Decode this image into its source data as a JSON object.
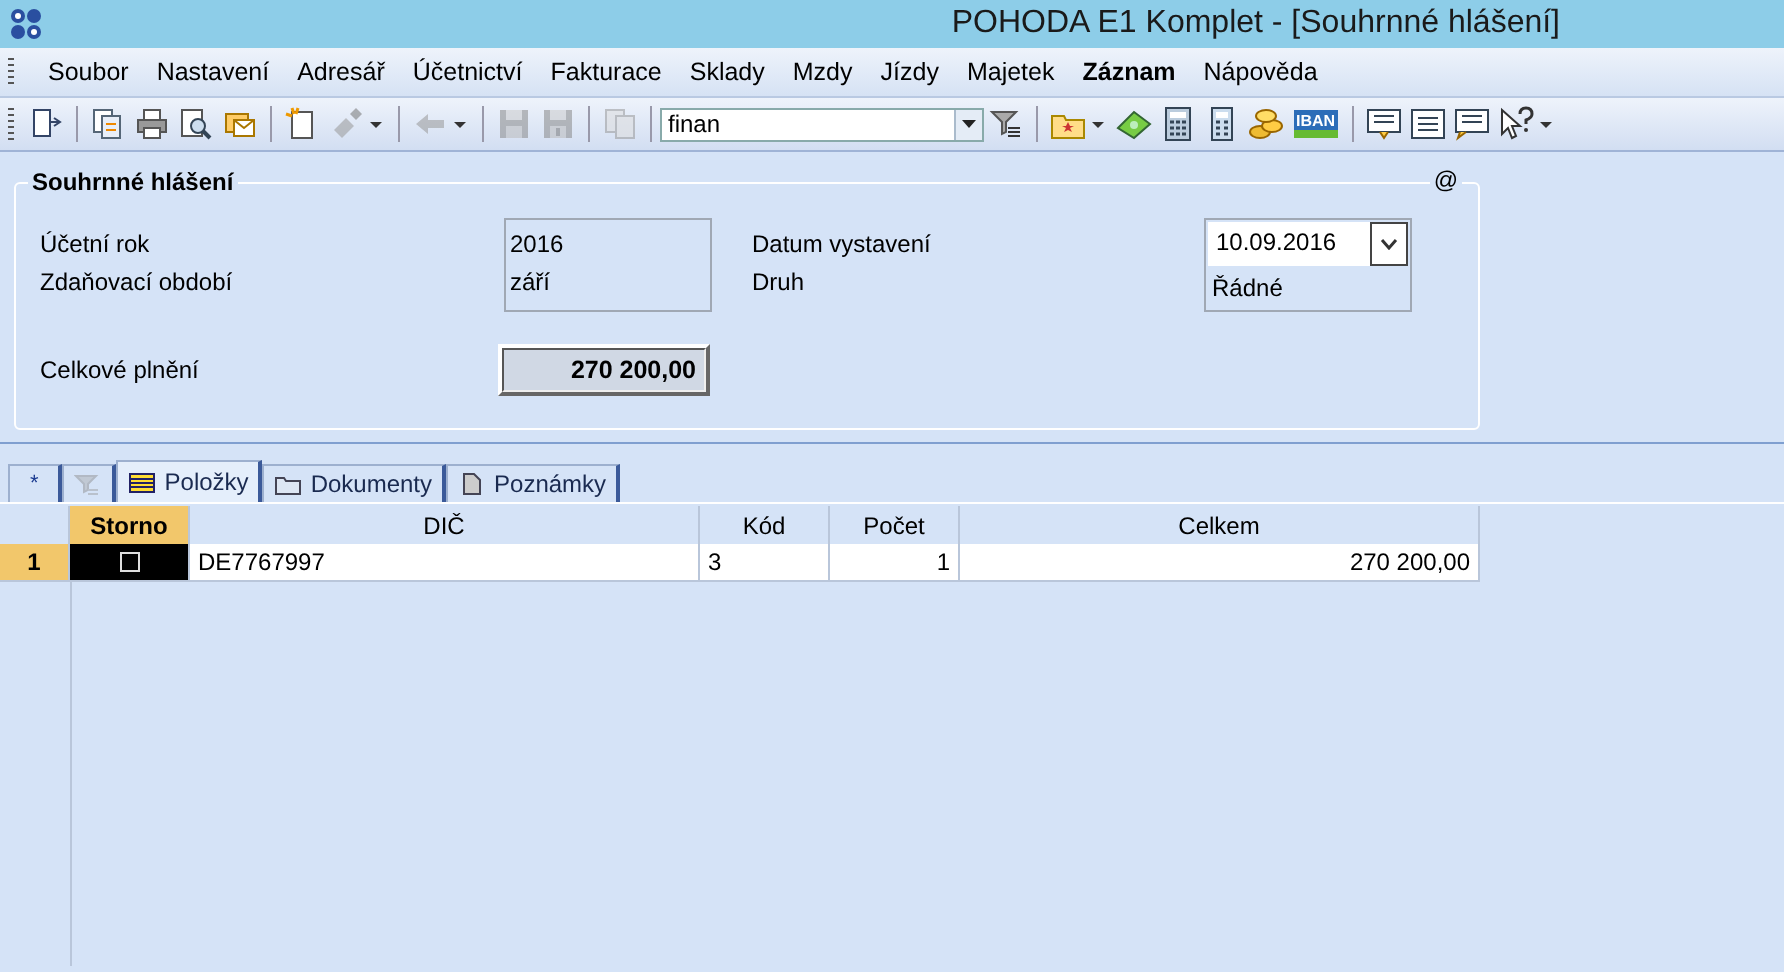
{
  "window": {
    "title": "POHODA E1 Komplet - [Souhrnné hlášení]"
  },
  "menu": [
    {
      "label": "Soubor",
      "emphasized": false
    },
    {
      "label": "Nastavení",
      "emphasized": false
    },
    {
      "label": "Adresář",
      "emphasized": false
    },
    {
      "label": "Účetnictví",
      "emphasized": false
    },
    {
      "label": "Fakturace",
      "emphasized": false
    },
    {
      "label": "Sklady",
      "emphasized": false
    },
    {
      "label": "Mzdy",
      "emphasized": false
    },
    {
      "label": "Jízdy",
      "emphasized": false
    },
    {
      "label": "Majetek",
      "emphasized": false
    },
    {
      "label": "Záznam",
      "emphasized": true
    },
    {
      "label": "Nápověda",
      "emphasized": false
    }
  ],
  "toolbar": [
    {
      "kind": "button",
      "disabled": false,
      "dropdown": false
    },
    {
      "kind": "separator"
    },
    {
      "kind": "button",
      "disabled": false,
      "dropdown": false
    },
    {
      "kind": "button",
      "disabled": false,
      "dropdown": false
    },
    {
      "kind": "button",
      "disabled": false,
      "dropdown": false
    },
    {
      "kind": "button",
      "disabled": false,
      "dropdown": false
    },
    {
      "kind": "separator"
    },
    {
      "kind": "button",
      "disabled": false,
      "dropdown": false
    },
    {
      "kind": "button",
      "disabled": true,
      "dropdown": true
    },
    {
      "kind": "separator"
    },
    {
      "kind": "button",
      "disabled": true,
      "dropdown": true
    },
    {
      "kind": "separator"
    },
    {
      "kind": "button",
      "disabled": true,
      "dropdown": false
    },
    {
      "kind": "button",
      "disabled": true,
      "dropdown": false
    },
    {
      "kind": "separator"
    },
    {
      "kind": "button",
      "disabled": true,
      "dropdown": false
    },
    {
      "kind": "separator"
    },
    {
      "kind": "combo",
      "value": "finan"
    },
    {
      "kind": "button",
      "disabled": false,
      "dropdown": false
    },
    {
      "kind": "separator"
    },
    {
      "kind": "button",
      "disabled": false,
      "dropdown": true
    },
    {
      "kind": "button",
      "disabled": false,
      "dropdown": false
    },
    {
      "kind": "button",
      "disabled": false,
      "dropdown": false
    },
    {
      "kind": "button",
      "disabled": false,
      "dropdown": false
    },
    {
      "kind": "button",
      "disabled": false,
      "dropdown": false
    },
    {
      "kind": "badge",
      "label": "IBAN"
    },
    {
      "kind": "separator"
    },
    {
      "kind": "button",
      "disabled": false,
      "dropdown": false
    },
    {
      "kind": "button",
      "disabled": false,
      "dropdown": false
    },
    {
      "kind": "button",
      "disabled": false,
      "dropdown": false
    },
    {
      "kind": "button",
      "disabled": false,
      "dropdown": true
    }
  ],
  "form": {
    "title": "Souhrnné hlášení",
    "corner_mark": "@",
    "ucetni_rok": {
      "label": "Účetní rok",
      "value": "2016"
    },
    "zdanovaci_obdobi": {
      "label": "Zdaňovací období",
      "value": "září"
    },
    "datum_vystaveni": {
      "label": "Datum vystavení",
      "value": "10.09.2016"
    },
    "druh": {
      "label": "Druh",
      "value": "Řádné"
    },
    "celkove_plneni": {
      "label": "Celkové plnění",
      "value": "270 200,00"
    }
  },
  "tabs": [
    {
      "label": "*",
      "selected": false,
      "disabled": false
    },
    {
      "selected": false,
      "disabled": true
    },
    {
      "label": "Položky",
      "selected": true,
      "disabled": false
    },
    {
      "label": "Dokumenty",
      "selected": false,
      "disabled": false
    },
    {
      "label": "Poznámky",
      "selected": false,
      "disabled": false
    }
  ],
  "table": {
    "columns": [
      {
        "label": "Storno",
        "selected": true
      },
      {
        "label": "DIČ",
        "selected": false
      },
      {
        "label": "Kód",
        "selected": false
      },
      {
        "label": "Počet",
        "selected": false
      },
      {
        "label": "Celkem",
        "selected": false
      }
    ],
    "rows": [
      {
        "number": "1",
        "selected": true,
        "storno": false,
        "dic": "DE7767997",
        "kod": "3",
        "pocet": "1",
        "celkem": "270 200,00"
      }
    ]
  }
}
